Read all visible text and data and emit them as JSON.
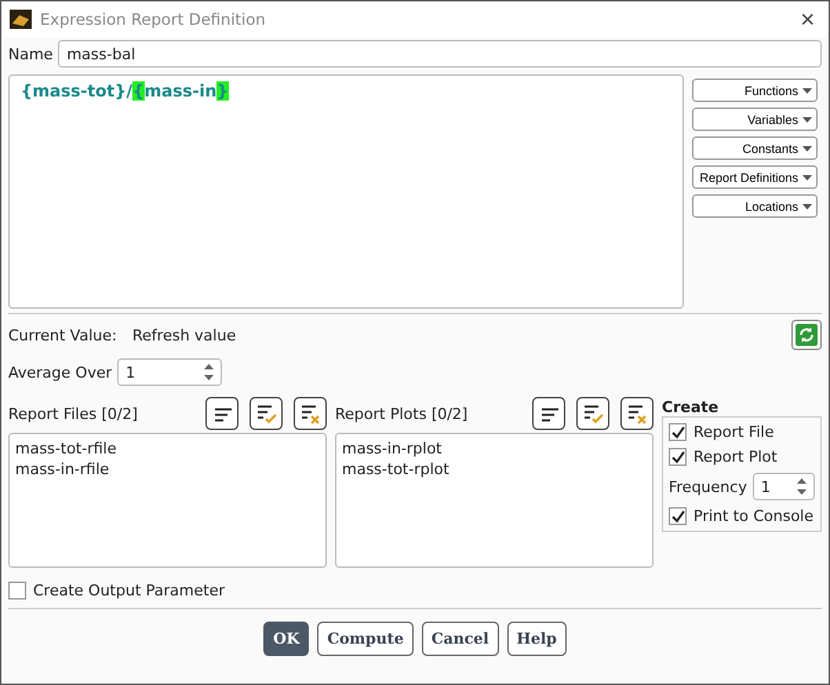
{
  "window": {
    "title": "Expression Report Definition",
    "close": "×"
  },
  "name": {
    "label": "Name",
    "value": "mass-bal"
  },
  "expression": [
    {
      "text": "{mass-tot}/",
      "highlight": false
    },
    {
      "text": "{",
      "highlight": true
    },
    {
      "text": "mass-in",
      "highlight": false
    },
    {
      "text": "}",
      "highlight": true
    }
  ],
  "side_menus": [
    "Functions",
    "Variables",
    "Constants",
    "Report Definitions",
    "Locations"
  ],
  "current_value": {
    "label": "Current Value:",
    "value": "Refresh value"
  },
  "average_over": {
    "label": "Average Over",
    "value": "1"
  },
  "report_files": {
    "title": "Report Files",
    "count": "[0/2]",
    "items": [
      {
        "label": "mass-tot-rfile",
        "selected": false
      },
      {
        "label": "mass-in-rfile",
        "selected": false
      }
    ]
  },
  "report_plots": {
    "title": "Report Plots",
    "count": "[0/2]",
    "items": [
      {
        "label": "mass-in-rplot",
        "selected": false
      },
      {
        "label": "mass-tot-rplot",
        "selected": false
      }
    ]
  },
  "create": {
    "title": "Create",
    "report_file": {
      "label": "Report File",
      "checked": true
    },
    "report_plot": {
      "label": "Report Plot",
      "checked": true
    },
    "frequency": {
      "label": "Frequency",
      "value": "1"
    },
    "print_to_console": {
      "label": "Print to Console",
      "checked": true
    }
  },
  "create_output_parameter": {
    "label": "Create Output Parameter",
    "checked": false
  },
  "buttons": [
    {
      "label": "OK",
      "primary": true
    },
    {
      "label": "Compute",
      "primary": false
    },
    {
      "label": "Cancel",
      "primary": false
    },
    {
      "label": "Help",
      "primary": false
    }
  ]
}
